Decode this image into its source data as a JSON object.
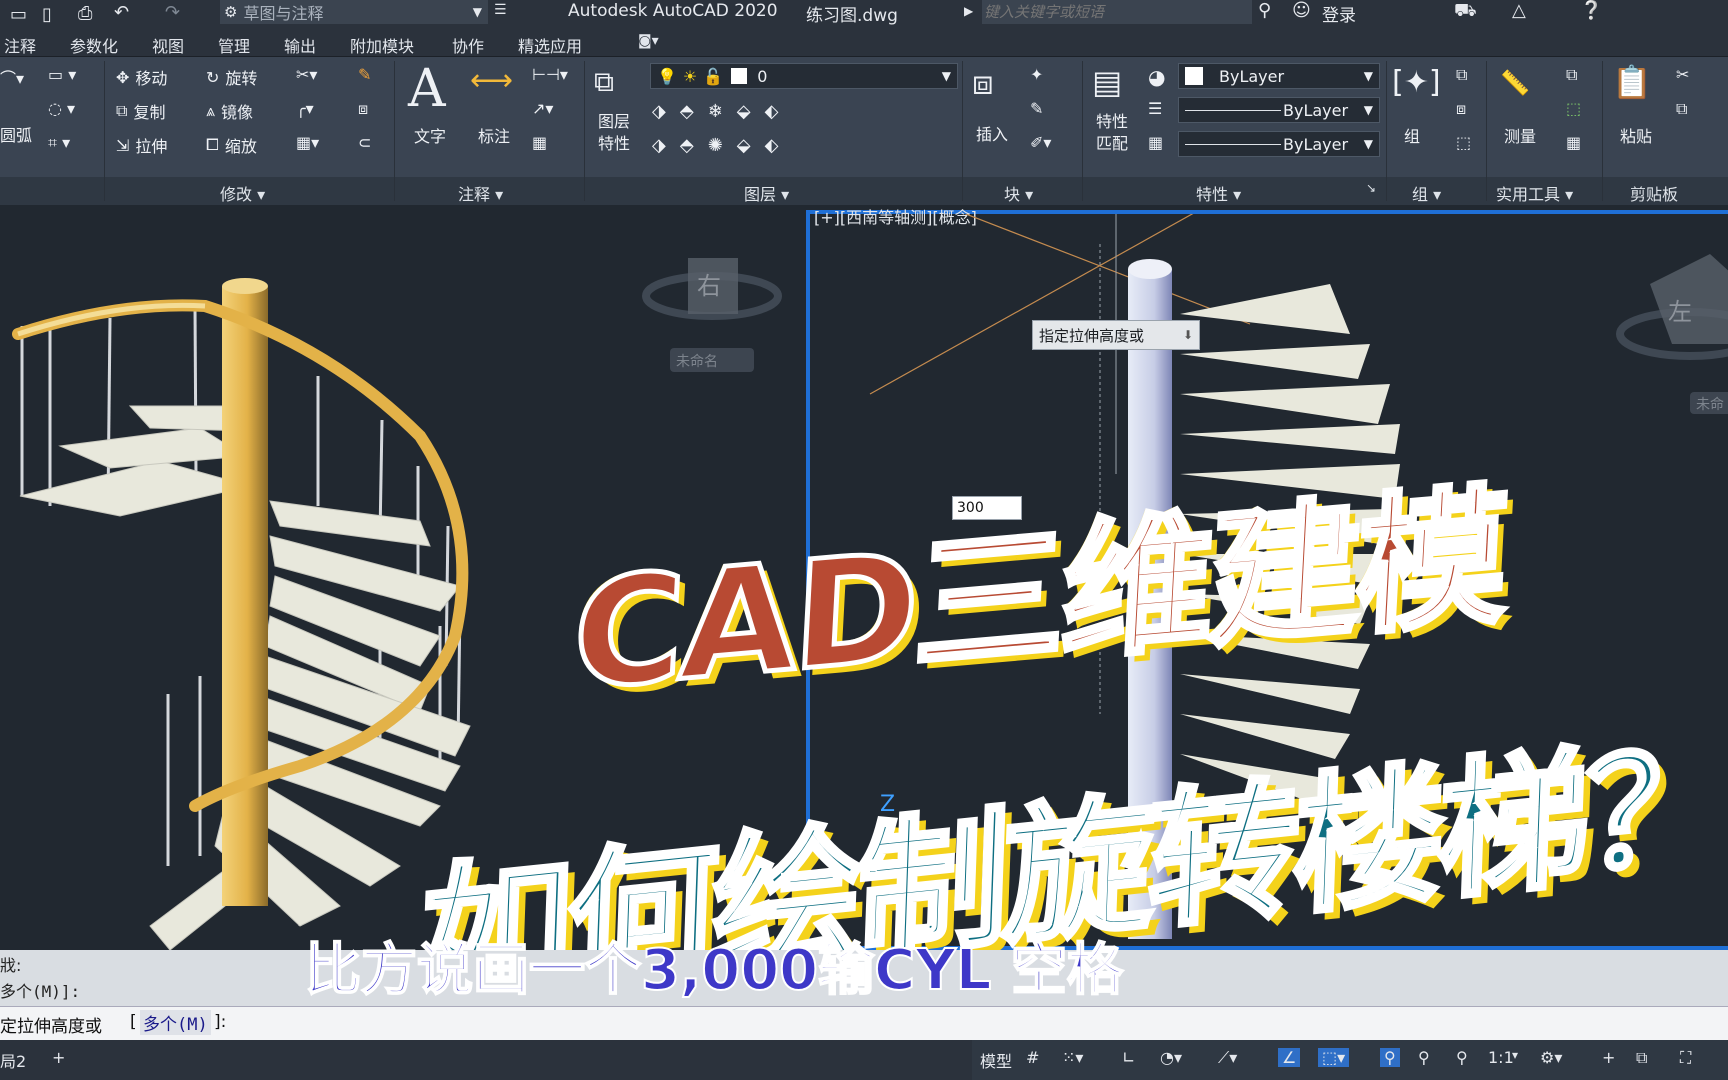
{
  "titlebar": {
    "workspace": "草图与注释",
    "app_title": "Autodesk AutoCAD 2020",
    "file_name": "练习图.dwg",
    "search_placeholder": "键入关键字或短语",
    "login_label": "登录"
  },
  "ribbon_tabs": [
    "注释",
    "参数化",
    "视图",
    "管理",
    "输出",
    "附加模块",
    "协作",
    "精选应用"
  ],
  "ribbon": {
    "draw_partial": "圆弧",
    "modify": {
      "title": "修改",
      "tools": [
        "移动",
        "旋转",
        "复制",
        "镜像",
        "拉伸",
        "缩放"
      ]
    },
    "annotation": {
      "title": "注释",
      "text_label": "文字",
      "dim_label": "标注"
    },
    "layers": {
      "title": "图层",
      "layer_props": "图层\n特性",
      "layer_props_1": "图层",
      "layer_props_2": "特性",
      "current_layer": "0"
    },
    "block": {
      "title": "块",
      "insert_label": "插入"
    },
    "properties": {
      "title": "特性",
      "match_1": "特性",
      "match_2": "匹配",
      "color": "ByLayer",
      "linetype": "ByLayer",
      "lineweight": "ByLayer"
    },
    "group": {
      "title": "组",
      "label": "组"
    },
    "utilities": {
      "title": "实用工具",
      "measure_label": "测量"
    },
    "clipboard": {
      "title": "剪贴板",
      "paste_label": "粘贴"
    }
  },
  "viewport_right": {
    "label": "[+][西南等轴测][概念]",
    "tooltip": "指定拉伸高度或",
    "input_value": "300"
  },
  "viewcube_left": {
    "face": "右",
    "tag": "未命名"
  },
  "viewcube_right": {
    "face": "左",
    "tag": "未命"
  },
  "command": {
    "history_1": "多个(M)]:",
    "history_0": "戕:",
    "prompt_prefix": "定拉伸高度或",
    "prompt_option": "多个(M)",
    "prompt_suffix": "]:",
    "prompt_bracket": "["
  },
  "overlay": {
    "title_line1": "CAD三维建模",
    "title_line2": "如何绘制旋转楼梯？",
    "subtitle": "比方说画一个3,000输CYL 空格"
  },
  "statusbar": {
    "model_label": "模型",
    "layout_tab": "局2",
    "scale": "1:1"
  },
  "colors": {
    "ribbon_bg": "#3a4452",
    "viewport_bg": "#212830",
    "active_border": "#1f6fd6",
    "title_red": "#b84a33",
    "title_teal": "#0e6f82",
    "title_yellow": "#f4d21b",
    "subtitle_blue": "#3e38c8",
    "stair_pole": "#e3b248",
    "stair_step": "#e8e8dc"
  }
}
